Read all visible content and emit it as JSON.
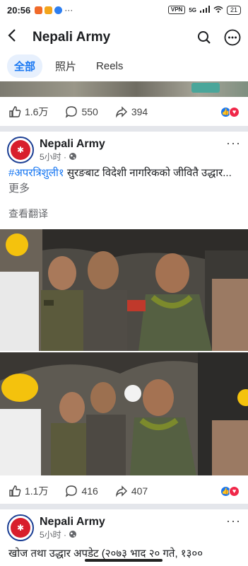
{
  "status_bar": {
    "time": "20:56",
    "vpn": "VPN",
    "network": "5G",
    "battery": "21"
  },
  "nav": {
    "title": "Nepali Army"
  },
  "tabs": [
    {
      "label": "全部"
    },
    {
      "label": "照片"
    },
    {
      "label": "Reels"
    }
  ],
  "post_prev": {
    "likes": "1.6万",
    "comments": "550",
    "shares": "394"
  },
  "post_main": {
    "author": "Nepali Army",
    "time": "5小时 ·",
    "hashtag": "#अपरत्रिशुली१",
    "text": " सुरङबाट विदेशी नागरिकको जीवितै उद्धार...",
    "more": " 更多",
    "translate": "查看翻译",
    "likes": "1.1万",
    "comments": "416",
    "shares": "407"
  },
  "post_next": {
    "author": "Nepali Army",
    "time": "5小时 ·",
    "text": "खोज तथा उद्धार अपडेट (२०७३ भाद २० गते, १३००"
  },
  "colors": {
    "accent": "#1877f2",
    "like": "#1877f2",
    "love": "#f0284a",
    "tab_active_bg": "#e7f0fd"
  }
}
